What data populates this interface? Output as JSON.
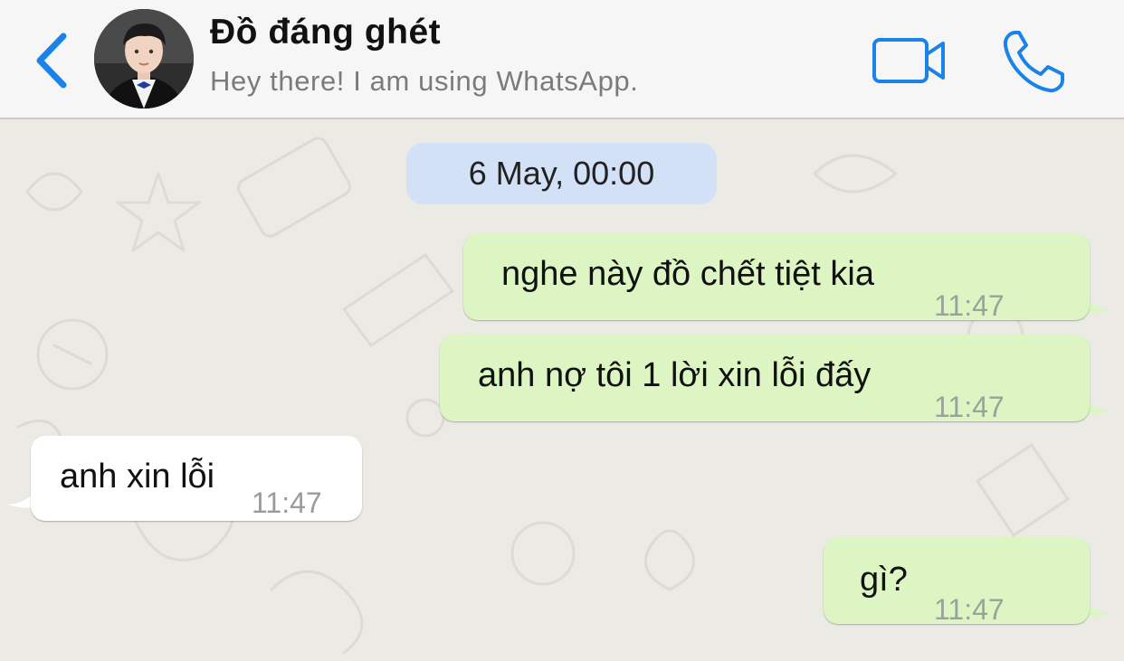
{
  "header": {
    "back_icon": "chevron-left-icon",
    "contact_name": "Đồ đáng ghét",
    "contact_status": "Hey there! I am using WhatsApp.",
    "video_icon": "video-camera-icon",
    "call_icon": "phone-icon",
    "accent_color": "#1a82e8"
  },
  "chat": {
    "date_label": "6 May, 00:00",
    "messages": [
      {
        "direction": "outgoing",
        "text": "nghe này đồ chết tiệt kia",
        "time": "11:47"
      },
      {
        "direction": "outgoing",
        "text": "anh nợ tôi 1 lời xin lỗi đấy",
        "time": "11:47"
      },
      {
        "direction": "incoming",
        "text": "anh xin lỗi",
        "time": "11:47"
      },
      {
        "direction": "outgoing",
        "text": "gì?",
        "time": "11:47"
      }
    ],
    "outgoing_bubble_color": "#dcf5c3",
    "incoming_bubble_color": "#ffffff"
  }
}
